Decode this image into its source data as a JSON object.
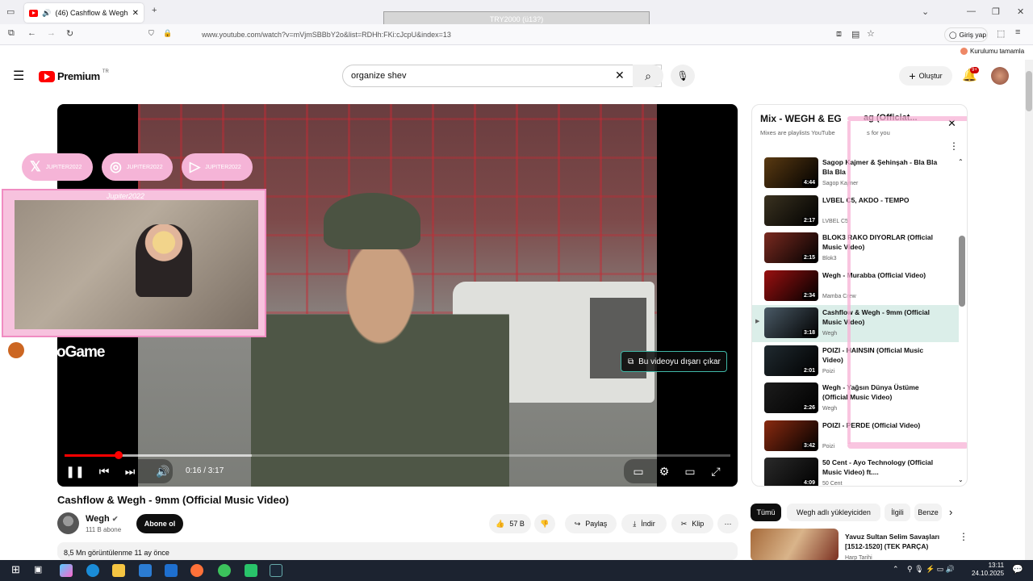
{
  "browser": {
    "tab_title": "(46) Cashflow & Wegh - 9m",
    "url": "www.youtube.com/watch?v=mVjmSBBbY2o&list=RDHh:FKi:cJcpU&index=13",
    "overlay_text": "TRY2000 (ü13?)",
    "login_label": "Giriş yap",
    "notice_label": "Kurulumu tamamla"
  },
  "youtube": {
    "logo_text": "Premium",
    "logo_region": "TR",
    "search_value": "organize shev",
    "create_label": "Oluştur",
    "notif_count": "9+"
  },
  "player": {
    "time": "0:16 / 3:17",
    "progress_fraction": 0.081,
    "popout_label": "Bu videoyu dışarı çıkar",
    "stream_overlay": {
      "socials": [
        "JUPITER2022",
        "JUPITER2022",
        "JUPITER2022"
      ],
      "webcam_name": "Jupiter2022",
      "game_tag": "oGame"
    }
  },
  "video": {
    "title": "Cashflow & Wegh - 9mm (Official Music Video)",
    "channel": "Wegh",
    "subscribers": "111 B abone",
    "subscribe_label": "Abone ol",
    "likes": "57 B",
    "share_label": "Paylaş",
    "download_label": "İndir",
    "clip_label": "Klip",
    "views_line": "8,5 Mn görüntülenme  11 ay önce"
  },
  "playlist": {
    "title": "Mix - WEGH & EG",
    "title_tail": "ag (Officiat...",
    "subtitle": "Mixes are playlists YouTube",
    "subtitle_tail": "s for you",
    "items": [
      {
        "title": "Sagop Kajmer & Şehinşah - Bla Bla Bla Bla",
        "channel": "Sagop Kajmer",
        "duration": "4:44",
        "color": "#5a3a12"
      },
      {
        "title": "LVBEL C5, AKDO - TEMPO",
        "channel": "LVBEL C5",
        "duration": "2:17",
        "color": "#3a3220"
      },
      {
        "title": "BLOK3 RAKO DIYORLAR (Official Music Video)",
        "channel": "Blok3",
        "duration": "2:15",
        "color": "#7a2a20"
      },
      {
        "title": "Wegh - Murabba (Official Video)",
        "channel": "Mamba Crew",
        "duration": "2:34",
        "color": "#9a1010"
      },
      {
        "title": "Cashflow & Wegh - 9mm (Official Music Video)",
        "channel": "Wegh",
        "duration": "3:18",
        "color": "#4a5a66",
        "active": true
      },
      {
        "title": "POIZI - HAINSIN (Official Music Video)",
        "channel": "Poizi",
        "duration": "2:01",
        "color": "#202a30"
      },
      {
        "title": "Wegh - Yağsın Dünya Üstüme (Official Music Video)",
        "channel": "Wegh",
        "duration": "2:26",
        "color": "#1c1c1c"
      },
      {
        "title": "POIZI - PERDE (Official Video)",
        "channel": "Poizi",
        "duration": "3:42",
        "color": "#8a2a10"
      },
      {
        "title": "50 Cent - Ayo Technology (Official Music Video) ft....",
        "channel": "50 Cent",
        "duration": "4:09",
        "color": "#2a2a2a"
      }
    ]
  },
  "chips": [
    "Tümü",
    "Wegh adlı yükleyiciden",
    "İlgili",
    "Benze"
  ],
  "recommended": {
    "title": "Yavuz Sultan Selim Savaşları [1512-1520] (TEK PARÇA)",
    "channel": "Harp Tarihi"
  },
  "taskbar": {
    "time": "13:11",
    "date": "24.10.2025"
  }
}
